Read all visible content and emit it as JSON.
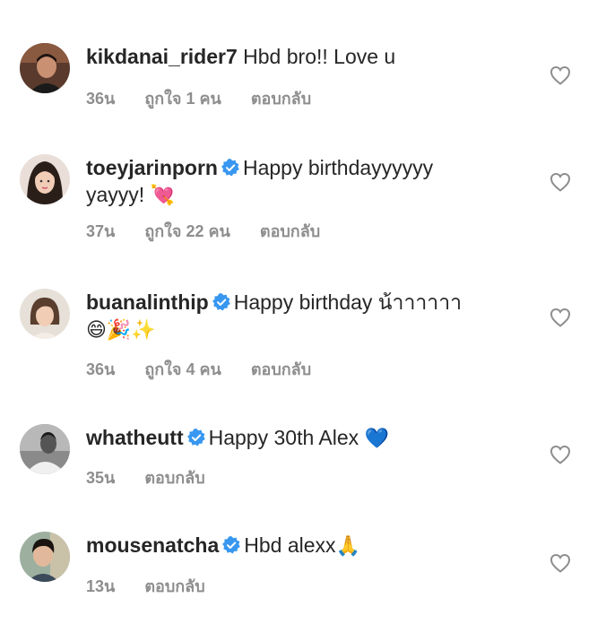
{
  "comments": [
    {
      "username": "kikdanai_rider7",
      "verified": false,
      "text": "Hbd bro!! Love u",
      "time": "36น",
      "likes": "ถูกใจ 1 คน",
      "reply": "ตอบกลับ"
    },
    {
      "username": "toeyjarinporn",
      "verified": true,
      "text": "Happy birthdayyyyyy",
      "text2": "yayyy!",
      "emoji": "💘",
      "time": "37น",
      "likes": "ถูกใจ 22 คน",
      "reply": "ตอบกลับ"
    },
    {
      "username": "buanalinthip",
      "verified": true,
      "text": "Happy birthday น้าาาาาา",
      "emoji": "😄🎉✨",
      "time": "36น",
      "likes": "ถูกใจ 4 คน",
      "reply": "ตอบกลับ"
    },
    {
      "username": "whatheutt",
      "verified": true,
      "text": "Happy 30th Alex",
      "emoji": "💙",
      "time": "35น",
      "reply": "ตอบกลับ"
    },
    {
      "username": "mousenatcha",
      "verified": true,
      "text": "Hbd alexx",
      "emoji": "🙏",
      "time": "13น",
      "reply": "ตอบกลับ"
    }
  ],
  "colors": {
    "text": "#262626",
    "meta": "#8e8e8e",
    "verified": "#3897f0"
  },
  "icons": {
    "verified": "verified-badge-icon",
    "like": "heart-outline-icon"
  }
}
